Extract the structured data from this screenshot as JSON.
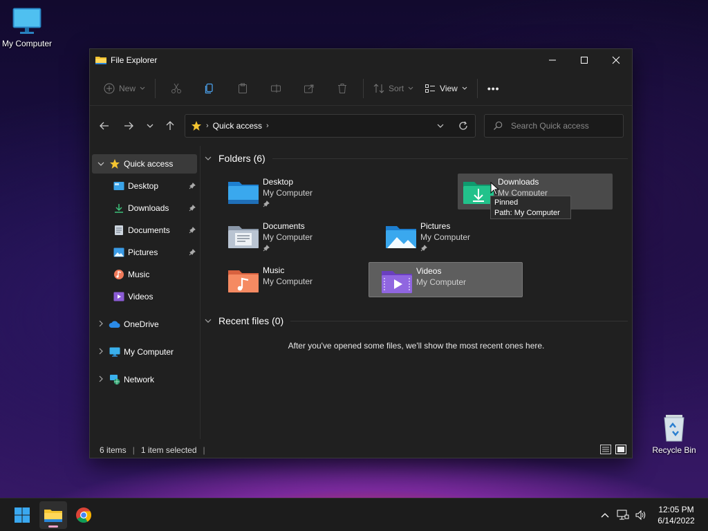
{
  "desktop": {
    "my_computer_label": "My Computer",
    "recycle_bin_label": "Recycle Bin"
  },
  "window": {
    "title": "File Explorer",
    "controls": {
      "minimize": "minimize",
      "maximize": "maximize",
      "close": "close"
    }
  },
  "toolbar": {
    "new_label": "New",
    "sort_label": "Sort",
    "view_label": "View",
    "more_label": "•••"
  },
  "address": {
    "crumb": "Quick access",
    "search_placeholder": "Search Quick access"
  },
  "sidebar": {
    "items": [
      {
        "label": "Quick access",
        "icon": "star-icon"
      },
      {
        "label": "Desktop",
        "icon": "desktop-folder-icon",
        "pinned": true
      },
      {
        "label": "Downloads",
        "icon": "download-icon",
        "pinned": true
      },
      {
        "label": "Documents",
        "icon": "documents-icon",
        "pinned": true
      },
      {
        "label": "Pictures",
        "icon": "pictures-icon",
        "pinned": true
      },
      {
        "label": "Music",
        "icon": "music-icon"
      },
      {
        "label": "Videos",
        "icon": "videos-icon"
      },
      {
        "label": "OneDrive",
        "icon": "cloud-icon"
      },
      {
        "label": "My Computer",
        "icon": "computer-icon"
      },
      {
        "label": "Network",
        "icon": "network-icon"
      }
    ]
  },
  "content": {
    "folders_header": "Folders (6)",
    "recent_header": "Recent files (0)",
    "empty_message": "After you've opened some files, we'll show the most recent ones here.",
    "folders": [
      {
        "name": "Desktop",
        "location": "My Computer",
        "pinned": true
      },
      {
        "name": "Downloads",
        "location": "My Computer",
        "pinned": true
      },
      {
        "name": "Documents",
        "location": "My Computer",
        "pinned": true
      },
      {
        "name": "Pictures",
        "location": "My Computer",
        "pinned": true
      },
      {
        "name": "Music",
        "location": "My Computer",
        "pinned": false
      },
      {
        "name": "Videos",
        "location": "My Computer",
        "pinned": false
      }
    ]
  },
  "tooltip": {
    "line1": "Pinned",
    "line2": "Path: My Computer"
  },
  "status": {
    "items": "6 items",
    "selected": "1 item selected"
  },
  "taskbar": {
    "time": "12:05 PM",
    "date": "6/14/2022"
  },
  "colors": {
    "window_bg": "#202020",
    "accent_yellow": "#f4c430",
    "selection": "#5e5e5e",
    "taskbar_bg": "#1c1c1c"
  }
}
